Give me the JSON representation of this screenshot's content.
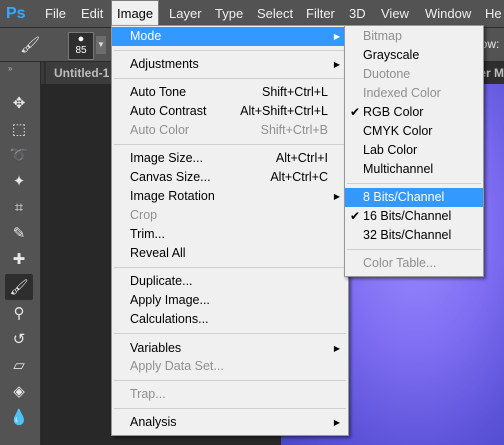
{
  "menubar": {
    "logo": "Ps",
    "items": [
      "File",
      "Edit",
      "Image",
      "Layer",
      "Type",
      "Select",
      "Filter",
      "3D",
      "View",
      "Window",
      "He"
    ]
  },
  "options": {
    "brush_size": "85",
    "flow_label": "low:"
  },
  "doc_tab": {
    "title": "Untitled-1 @",
    "right_fragment": "er M"
  },
  "image_menu": {
    "items": [
      {
        "label": "Mode",
        "shortcut": "",
        "submenu": true,
        "highlighted": true
      },
      {
        "label": "Adjustments",
        "shortcut": "",
        "submenu": true
      },
      {
        "label": "Auto Tone",
        "shortcut": "Shift+Ctrl+L"
      },
      {
        "label": "Auto Contrast",
        "shortcut": "Alt+Shift+Ctrl+L"
      },
      {
        "label": "Auto Color",
        "shortcut": "Shift+Ctrl+B",
        "disabled": true
      },
      {
        "label": "Image Size...",
        "shortcut": "Alt+Ctrl+I"
      },
      {
        "label": "Canvas Size...",
        "shortcut": "Alt+Ctrl+C"
      },
      {
        "label": "Image Rotation",
        "shortcut": "",
        "submenu": true
      },
      {
        "label": "Crop",
        "shortcut": "",
        "disabled": true
      },
      {
        "label": "Trim...",
        "shortcut": ""
      },
      {
        "label": "Reveal All",
        "shortcut": ""
      },
      {
        "label": "Duplicate...",
        "shortcut": ""
      },
      {
        "label": "Apply Image...",
        "shortcut": ""
      },
      {
        "label": "Calculations...",
        "shortcut": ""
      },
      {
        "label": "Variables",
        "shortcut": "",
        "submenu": true
      },
      {
        "label": "Apply Data Set...",
        "shortcut": "",
        "disabled": true
      },
      {
        "label": "Trap...",
        "shortcut": "",
        "disabled": true
      },
      {
        "label": "Analysis",
        "shortcut": "",
        "submenu": true
      }
    ]
  },
  "mode_menu": {
    "items": [
      {
        "label": "Bitmap",
        "disabled": true
      },
      {
        "label": "Grayscale"
      },
      {
        "label": "Duotone",
        "disabled": true
      },
      {
        "label": "Indexed Color",
        "disabled": true
      },
      {
        "label": "RGB Color",
        "checked": true
      },
      {
        "label": "CMYK Color"
      },
      {
        "label": "Lab Color"
      },
      {
        "label": "Multichannel"
      },
      {
        "label": "8 Bits/Channel",
        "highlighted": true
      },
      {
        "label": "16 Bits/Channel",
        "checked": true
      },
      {
        "label": "32 Bits/Channel"
      },
      {
        "label": "Color Table...",
        "disabled": true
      }
    ]
  },
  "glyphs": {
    "submenu_arrow": "▶",
    "check": "✔"
  },
  "tools": [
    "move-tool-icon",
    "marquee-tool-icon",
    "lasso-tool-icon",
    "magic-wand-icon",
    "crop-tool-icon",
    "eyedropper-icon",
    "healing-brush-icon",
    "brush-tool-icon",
    "clone-stamp-icon",
    "history-brush-icon",
    "eraser-icon",
    "paint-bucket-icon",
    "blur-tool-icon"
  ]
}
